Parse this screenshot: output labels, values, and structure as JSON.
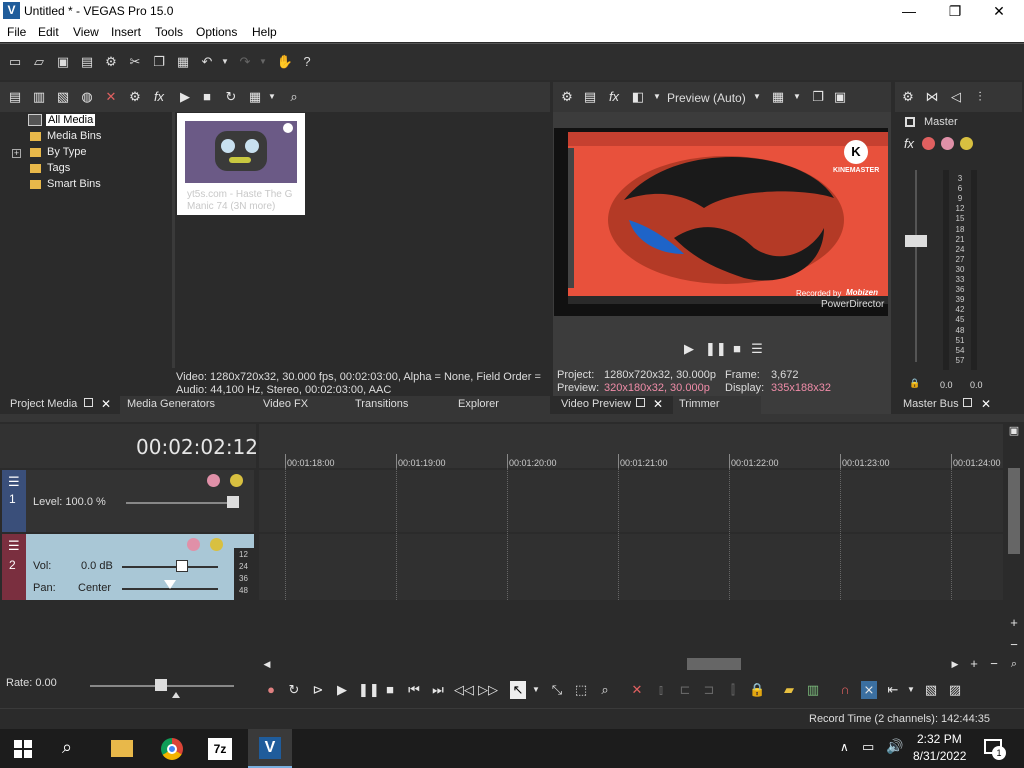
{
  "window": {
    "app_icon": "V",
    "title": "Untitled * - VEGAS Pro 15.0",
    "minimize": "—",
    "maximize": "❐",
    "close": "✕"
  },
  "menu": [
    "File",
    "Edit",
    "View",
    "Insert",
    "Tools",
    "Options",
    "Help"
  ],
  "media_tree": [
    "All Media",
    "Media Bins",
    "By Type",
    "Tags",
    "Smart Bins"
  ],
  "media_tree_expand": "+",
  "thumbnail": {
    "caption": "yt5s.com - Haste The G Manic 74 (3N more)"
  },
  "media_info": {
    "video": "Video: 1280x720x32, 30.000 fps, 00:02:03:00, Alpha = None, Field Order =",
    "audio": "Audio: 44,100 Hz, Stereo, 00:02:03:00, AAC"
  },
  "bottom_tabs_left": [
    "Project Media",
    "Media Generators",
    "Video FX",
    "Transitions",
    "Explorer"
  ],
  "preview": {
    "mode": "Preview (Auto)",
    "watermark_kinemaster": "KINEMASTER",
    "watermark_recorded": "Recorded by",
    "watermark_recorded_brand": "Mobizen",
    "watermark_powerdirector": "PowerDirector",
    "project_label": "Project:",
    "project_value": "1280x720x32, 30.000p",
    "frame_label": "Frame:",
    "frame_value": "3,672",
    "preview_label": "Preview:",
    "preview_value": "320x180x32, 30.000p",
    "display_label": "Display:",
    "display_value": "335x188x32"
  },
  "preview_tabs": [
    "Video Preview",
    "Trimmer"
  ],
  "master": {
    "label": "Master",
    "scale": [
      "3",
      "6",
      "9",
      "12",
      "15",
      "18",
      "21",
      "24",
      "27",
      "30",
      "33",
      "36",
      "39",
      "42",
      "45",
      "48",
      "51",
      "54",
      "57"
    ],
    "left_value": "0.0",
    "right_value": "0.0",
    "tab": "Master Bus"
  },
  "timeline": {
    "time_display": "00:02:02:12",
    "ruler": [
      "00:01:18:00",
      "00:01:19:00",
      "00:01:20:00",
      "00:01:21:00",
      "00:01:22:00",
      "00:01:23:00",
      "00:01:24:00"
    ],
    "track1": {
      "number": "1",
      "level_label": "Level: 100.0 %"
    },
    "track2": {
      "number": "2",
      "vol_label": "Vol:",
      "vol_value": "0.0 dB",
      "pan_label": "Pan:",
      "pan_value": "Center",
      "meter": [
        "12",
        "24",
        "36",
        "48"
      ]
    },
    "rate": "Rate: 0.00"
  },
  "status": {
    "record_time": "Record Time (2 channels): 142:44:35"
  },
  "taskbar": {
    "time": "2:32 PM",
    "date": "8/31/2022",
    "notification_count": "1",
    "app_7z": "7z",
    "app_vegas": "V"
  },
  "colors": {
    "track1_header": "#3a4f7a",
    "track2_header": "#a9c7d6",
    "accent_pink": "#f08ca8",
    "folder": "#e8b84a"
  }
}
